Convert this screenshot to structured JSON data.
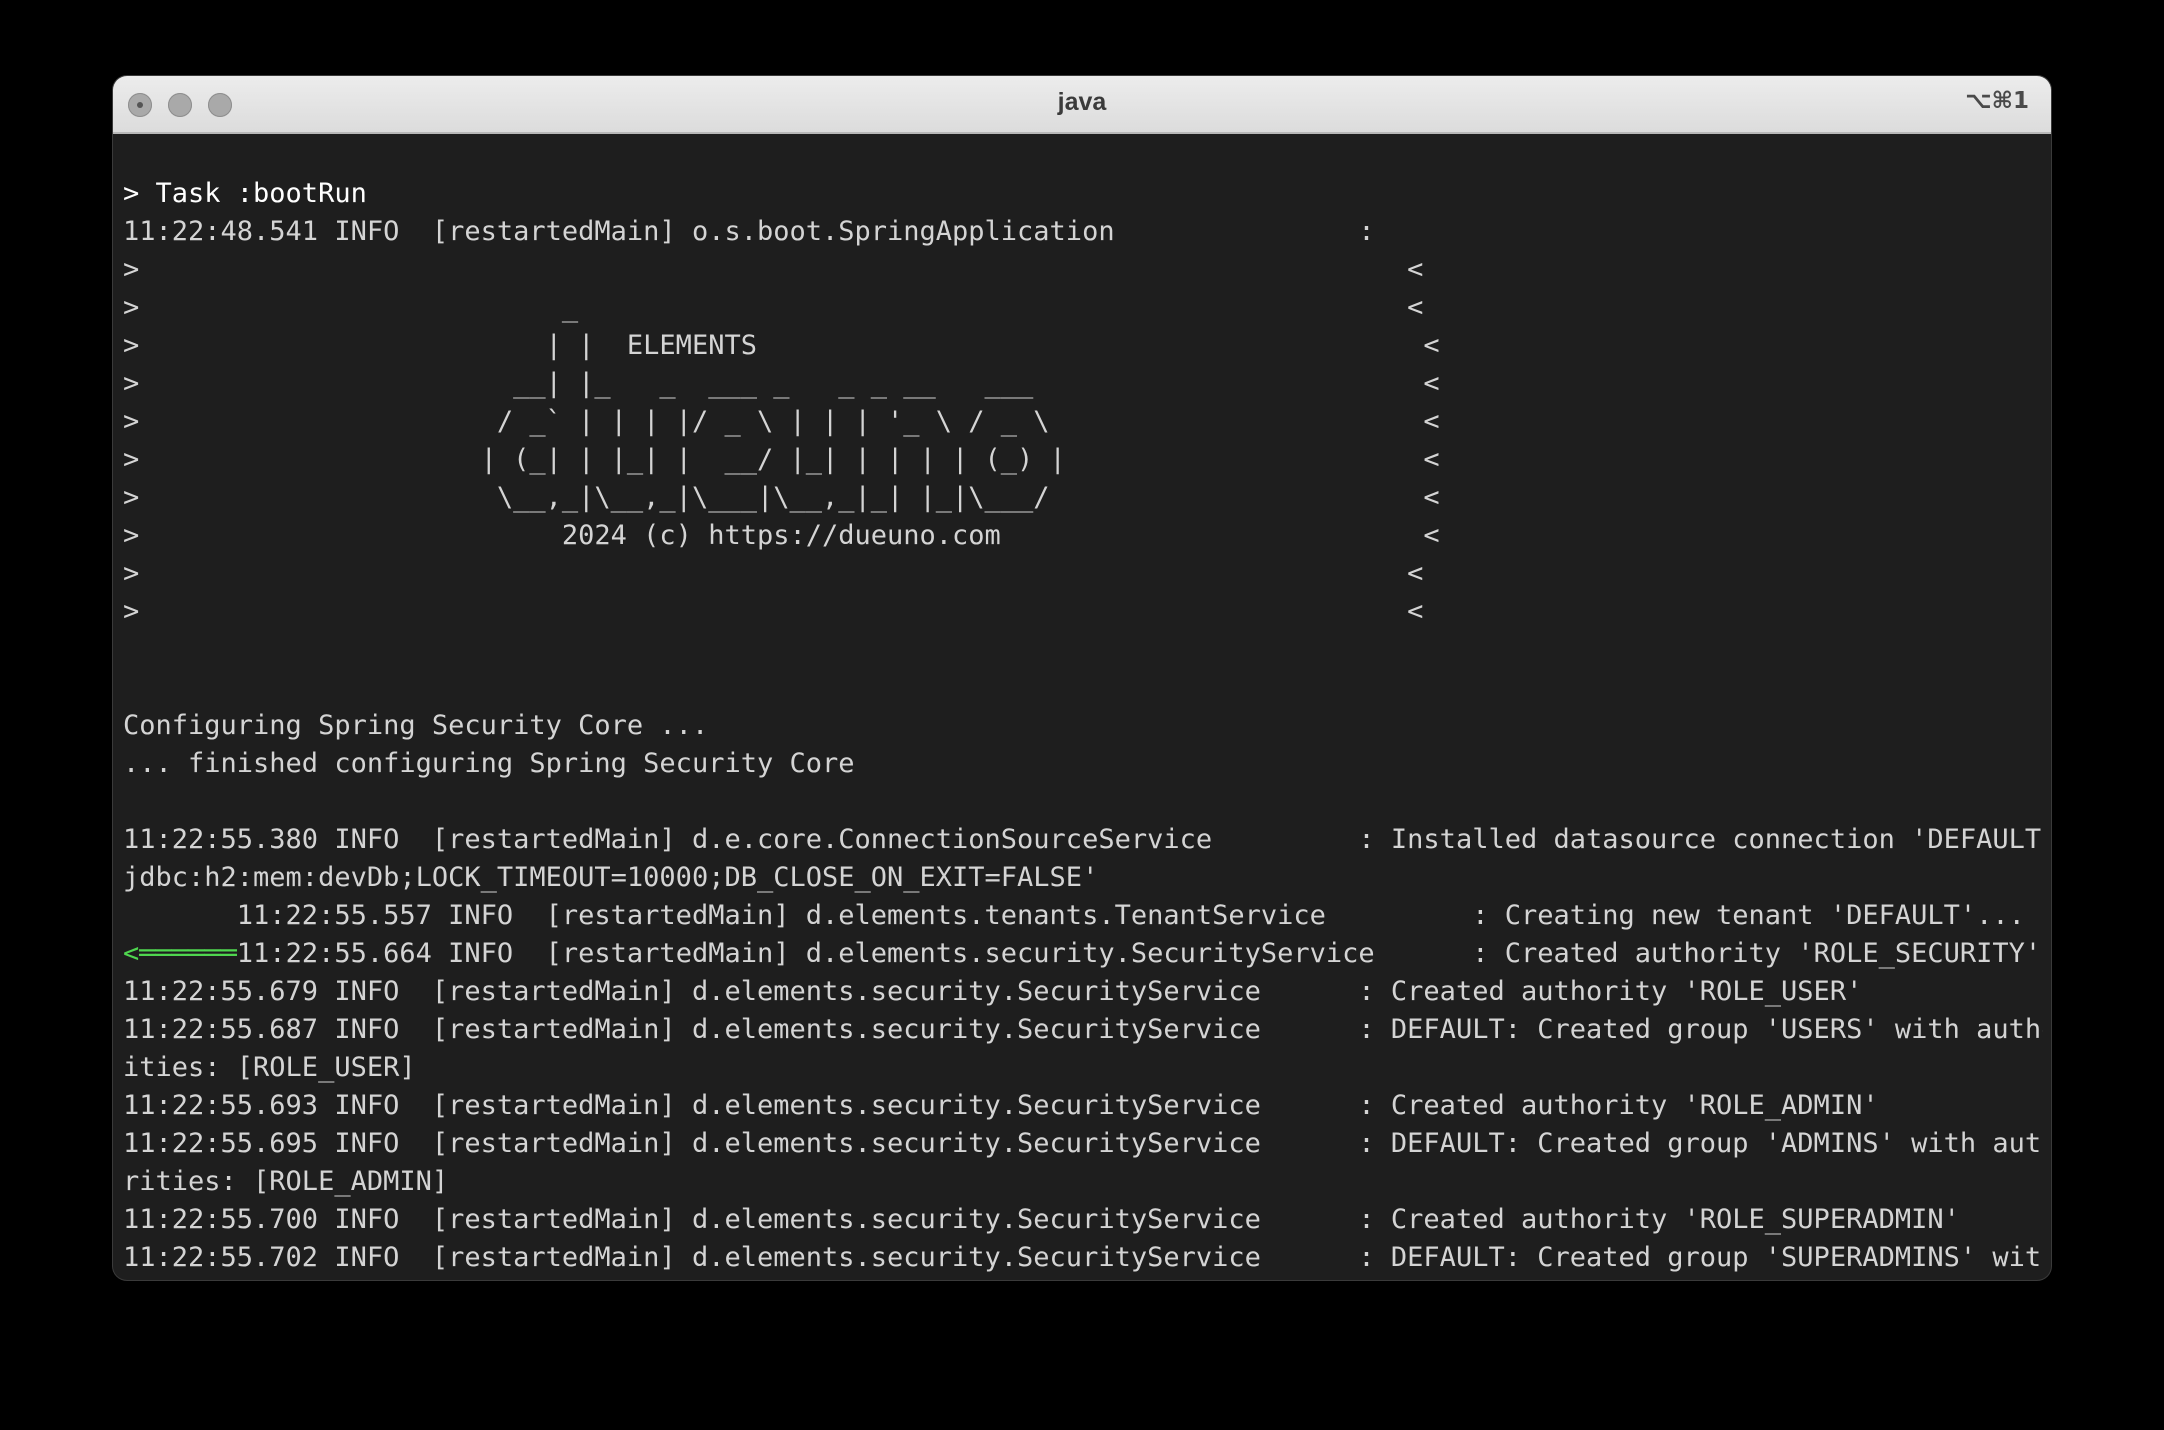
{
  "window": {
    "title": "java",
    "shortcut": "⌥⌘1"
  },
  "terminal": {
    "lines": [
      "> Task :bootRun",
      "11:22:48.541 INFO  [restartedMain] o.s.boot.SpringApplication               :",
      ">                                                                              <",
      ">                          _                                                   <",
      ">                         | |  ELEMENTS                                         <",
      ">                       __| |_   _  ___ _   _ _ __   ___                        <",
      ">                      / _` | | | |/ _ \\ | | | '_ \\ / _ \\                       <",
      ">                     | (_| | |_| |  __/ |_| | | | | (_) |                      <",
      ">                      \\__,_|\\__,_|\\___|\\__,_|_| |_|\\___/                       <",
      ">                          2024 (c) https://dueuno.com                          <",
      ">                                                                              <",
      ">                                                                              <",
      "",
      "",
      "Configuring Spring Security Core ...",
      "... finished configuring Spring Security Core",
      "",
      "11:22:55.380 INFO  [restartedMain] d.e.core.ConnectionSourceService         : Installed datasource connection 'DEFAULT:",
      "jdbc:h2:mem:devDb;LOCK_TIMEOUT=10000;DB_CLOSE_ON_EXIT=FALSE'",
      "       11:22:55.557 INFO  [restartedMain] d.elements.tenants.TenantService         : Creating new tenant 'DEFAULT'...",
      "11:22:55.664 INFO  [restartedMain] d.elements.security.SecurityService      : Created authority 'ROLE_SECURITY'",
      "11:22:55.679 INFO  [restartedMain] d.elements.security.SecurityService      : Created authority 'ROLE_USER'",
      "11:22:55.687 INFO  [restartedMain] d.elements.security.SecurityService      : DEFAULT: Created group 'USERS' with author",
      "ities: [ROLE_USER]",
      "11:22:55.693 INFO  [restartedMain] d.elements.security.SecurityService      : Created authority 'ROLE_ADMIN'",
      "11:22:55.695 INFO  [restartedMain] d.elements.security.SecurityService      : DEFAULT: Created group 'ADMINS' with autho",
      "rities: [ROLE_ADMIN]",
      "11:22:55.700 INFO  [restartedMain] d.elements.security.SecurityService      : Created authority 'ROLE_SUPERADMIN'",
      "11:22:55.702 INFO  [restartedMain] d.elements.security.SecurityService      : DEFAULT: Created group 'SUPERADMINS' with"
    ],
    "arrow_prefix": "<══════",
    "arrow_line_index": 20
  },
  "colors": {
    "background": "#1e1e1e",
    "text": "#d4d4d4",
    "bright_text": "#ffffff",
    "arrow": "#4fd64f"
  }
}
